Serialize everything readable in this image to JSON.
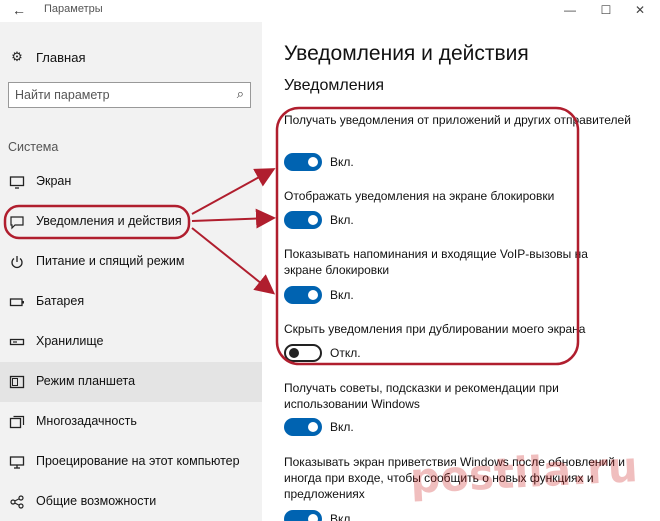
{
  "window": {
    "title": "Параметры"
  },
  "sidebar": {
    "home_label": "Главная",
    "search_placeholder": "Найти параметр",
    "section_label": "Система",
    "items": [
      {
        "label": "Экран",
        "icon": "display-icon",
        "active": false
      },
      {
        "label": "Уведомления и действия",
        "icon": "notifications-icon",
        "active": false,
        "highlighted": true
      },
      {
        "label": "Питание и спящий режим",
        "icon": "power-icon",
        "active": false
      },
      {
        "label": "Батарея",
        "icon": "battery-icon",
        "active": false
      },
      {
        "label": "Хранилище",
        "icon": "storage-icon",
        "active": false
      },
      {
        "label": "Режим планшета",
        "icon": "tablet-mode-icon",
        "active": true
      },
      {
        "label": "Многозадачность",
        "icon": "multitasking-icon",
        "active": false
      },
      {
        "label": "Проецирование на этот компьютер",
        "icon": "projecting-icon",
        "active": false
      },
      {
        "label": "Общие возможности",
        "icon": "shared-experiences-icon",
        "active": false
      }
    ]
  },
  "main": {
    "title": "Уведомления и действия",
    "subtitle": "Уведомления",
    "options": [
      {
        "text": "Получать уведомления от приложений и других отправителей",
        "state": "Вкл.",
        "on": true
      },
      {
        "text": "Отображать уведомления на экране блокировки",
        "state": "Вкл.",
        "on": true
      },
      {
        "text": "Показывать напоминания и входящие VoIP-вызовы на экране блокировки",
        "state": "Вкл.",
        "on": true
      },
      {
        "text": "Скрыть уведомления при дублировании моего экрана",
        "state": "Откл.",
        "on": false
      },
      {
        "text": "Получать советы, подсказки и рекомендации при использовании Windows",
        "state": "Вкл.",
        "on": true
      },
      {
        "text": "Показывать экран приветствия Windows после обновлений и иногда при входе, чтобы сообщить о новых функциях и предложениях",
        "state": "Вкл.",
        "on": true
      }
    ]
  },
  "colors": {
    "accent": "#0063b1",
    "annotation": "#b01e2e",
    "sidebar_bg": "#f2f2f2"
  },
  "watermark": "postila.ru"
}
